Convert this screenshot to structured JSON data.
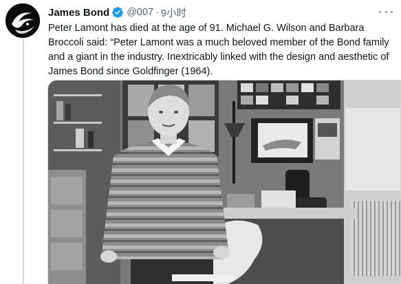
{
  "tweet": {
    "display_name": "James Bond",
    "handle": "@007",
    "separator": "·",
    "time": "9小时",
    "text": "Peter Lamont has died at the age of 91. Michael G. Wilson and Barbara Broccoli said: “Peter Lamont was a much beloved member of the Bond family and a giant in the industry. Inextricably linked with the design and aesthetic of James Bond since Goldfinger (1964).",
    "verified_icon": "verified-badge-icon",
    "more_icon": "more-options-icon",
    "verified_color": "#1d9bf0"
  },
  "photo": {
    "description_icon": "black-and-white-photo"
  }
}
